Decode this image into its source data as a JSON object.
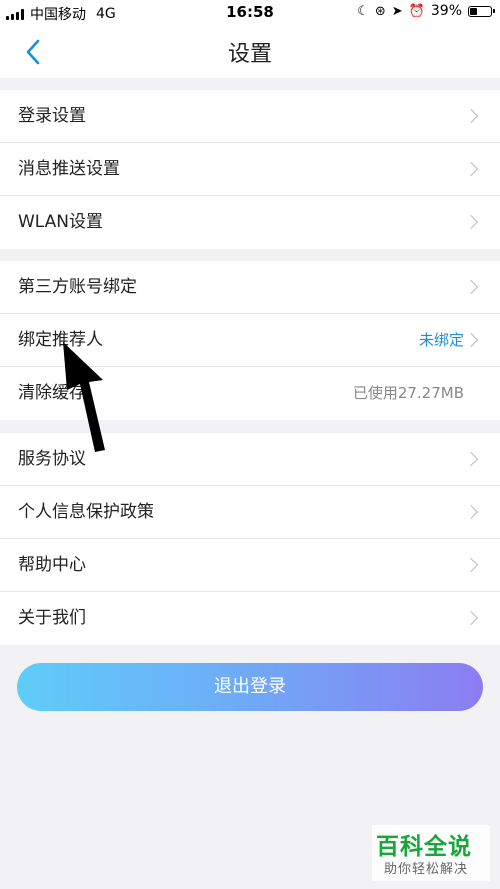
{
  "status_bar": {
    "carrier": "中国移动",
    "network": "4G",
    "time": "16:58",
    "battery": "39%",
    "battery_level": 0.39,
    "icons": [
      "moon-icon",
      "rotation-lock-icon",
      "location-icon",
      "alarm-icon"
    ]
  },
  "nav": {
    "title": "设置",
    "back_icon": "chevron-left-icon",
    "accent_color": "#1a8fd6"
  },
  "groups": [
    {
      "items": [
        {
          "label": "登录设置"
        },
        {
          "label": "消息推送设置"
        },
        {
          "label": "WLAN设置"
        }
      ]
    },
    {
      "items": [
        {
          "label": "第三方账号绑定"
        },
        {
          "label": "绑定推荐人",
          "value": "未绑定"
        },
        {
          "label": "清除缓存",
          "value": "已使用27.27MB"
        }
      ]
    },
    {
      "items": [
        {
          "label": "服务协议"
        },
        {
          "label": "个人信息保护政策"
        },
        {
          "label": "帮助中心"
        },
        {
          "label": "关于我们"
        }
      ]
    }
  ],
  "logout": {
    "label": "退出登录",
    "gradient": [
      "#5fcdf9",
      "#8c7df2"
    ]
  },
  "watermark": {
    "title": "百科全说",
    "subtitle": "助你轻松解决"
  }
}
